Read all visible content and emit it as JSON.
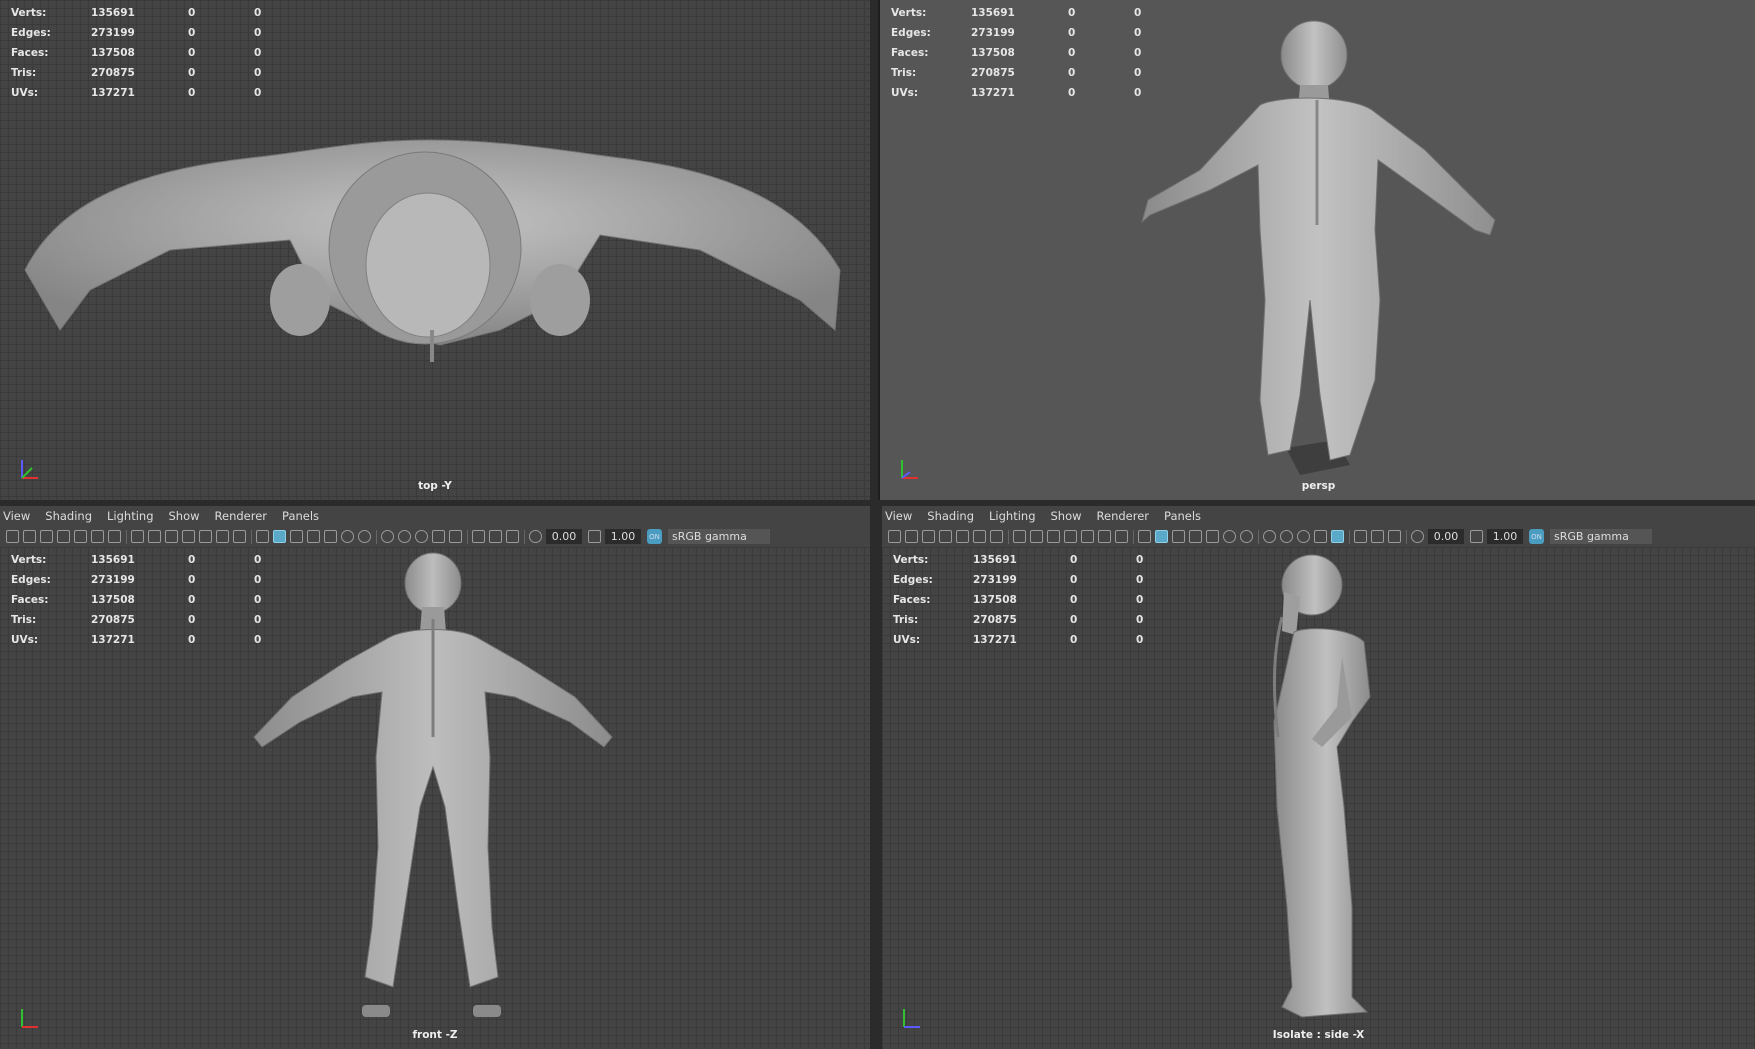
{
  "hud": {
    "rows": [
      {
        "label": "Verts:",
        "v1": "135691",
        "v2": "0",
        "v3": "0"
      },
      {
        "label": "Edges:",
        "v1": "273199",
        "v2": "0",
        "v3": "0"
      },
      {
        "label": "Faces:",
        "v1": "137508",
        "v2": "0",
        "v3": "0"
      },
      {
        "label": "Tris:",
        "v1": "270875",
        "v2": "0",
        "v3": "0"
      },
      {
        "label": "UVs:",
        "v1": "137271",
        "v2": "0",
        "v3": "0"
      }
    ]
  },
  "viewports": {
    "top": {
      "label": "top -Y"
    },
    "persp": {
      "label": "persp"
    },
    "front": {
      "label": "front -Z"
    },
    "side": {
      "label": "Isolate : side -X"
    }
  },
  "panel_menu": {
    "view": "View",
    "shading": "Shading",
    "lighting": "Lighting",
    "show": "Show",
    "renderer": "Renderer",
    "panels": "Panels"
  },
  "toolbar": {
    "exposure": "0.00",
    "gamma": "1.00",
    "color_mgmt_icon": "ON",
    "color_space": "sRGB gamma",
    "icons": [
      "camera-icon",
      "bookmark-icon",
      "grid-icon",
      "wireframe-icon",
      "shaded-icon",
      "lighting-icon",
      "isolate-icon",
      "xray-icon",
      "exposure-icon",
      "gamma-icon"
    ]
  },
  "colors": {
    "viewport_bg": "#444444",
    "persp_bg": "#565656",
    "panel_bg": "#444444",
    "accent": "#5aa9c9",
    "model": "#a8a8a8"
  }
}
